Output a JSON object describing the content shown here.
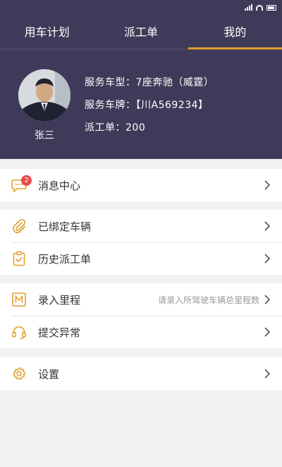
{
  "colors": {
    "header_bg": "#3f3a59",
    "accent": "#e0a02f",
    "badge": "#e84a4a",
    "icon": "#e0a02f"
  },
  "tabs": [
    {
      "label": "用车计划",
      "active": false
    },
    {
      "label": "派工单",
      "active": false
    },
    {
      "label": "我的",
      "active": true
    }
  ],
  "profile": {
    "name": "张三",
    "vehicle_type": "服务车型：7座奔驰（威霆）",
    "plate": "服务车牌：【川A569234】",
    "orders": "派工单：200"
  },
  "menu": {
    "messages": {
      "label": "消息中心",
      "badge": "2",
      "icon": "chat-bubble-icon"
    },
    "bound_vehicle": {
      "label": "已绑定车辆",
      "icon": "paperclip-icon"
    },
    "history": {
      "label": "历史派工单",
      "icon": "clipboard-check-icon"
    },
    "mileage": {
      "label": "录入里程",
      "hint": "请录入所驾驶车辆总里程数",
      "icon": "m-box-icon"
    },
    "report": {
      "label": "提交异常",
      "icon": "headset-icon"
    },
    "settings": {
      "label": "设置",
      "icon": "gear-icon"
    }
  }
}
